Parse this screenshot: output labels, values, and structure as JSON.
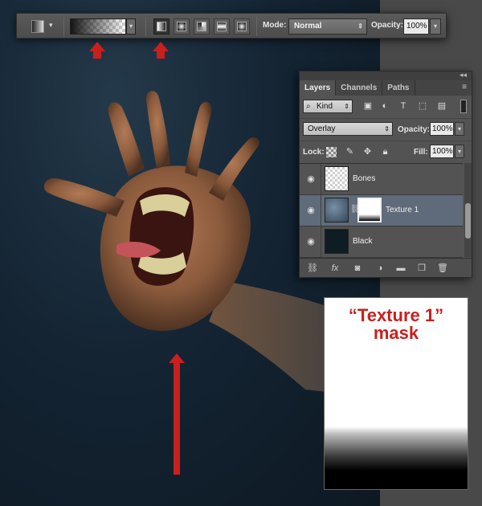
{
  "options_bar": {
    "mode_label": "Mode:",
    "mode_value": "Normal",
    "opacity_label": "Opacity:",
    "opacity_value": "100%"
  },
  "layers_panel": {
    "tabs": [
      {
        "label": "Layers",
        "active": true
      },
      {
        "label": "Channels",
        "active": false
      },
      {
        "label": "Paths",
        "active": false
      }
    ],
    "filter_kind": "Kind",
    "blend_mode": "Overlay",
    "opacity_label": "Opacity:",
    "opacity_value": "100%",
    "lock_label": "Lock:",
    "fill_label": "Fill:",
    "fill_value": "100%",
    "layers": [
      {
        "name": "Bones",
        "visible": true,
        "selected": false
      },
      {
        "name": "Texture 1",
        "visible": true,
        "selected": true,
        "has_mask": true
      },
      {
        "name": "Black",
        "visible": true,
        "selected": false
      }
    ]
  },
  "annotation": {
    "mask_title_line1": "“Texture 1”",
    "mask_title_line2": "mask"
  },
  "colors": {
    "accent_red": "#c8201f",
    "canvas_dark": "#142433",
    "panel_gray": "#535353"
  }
}
